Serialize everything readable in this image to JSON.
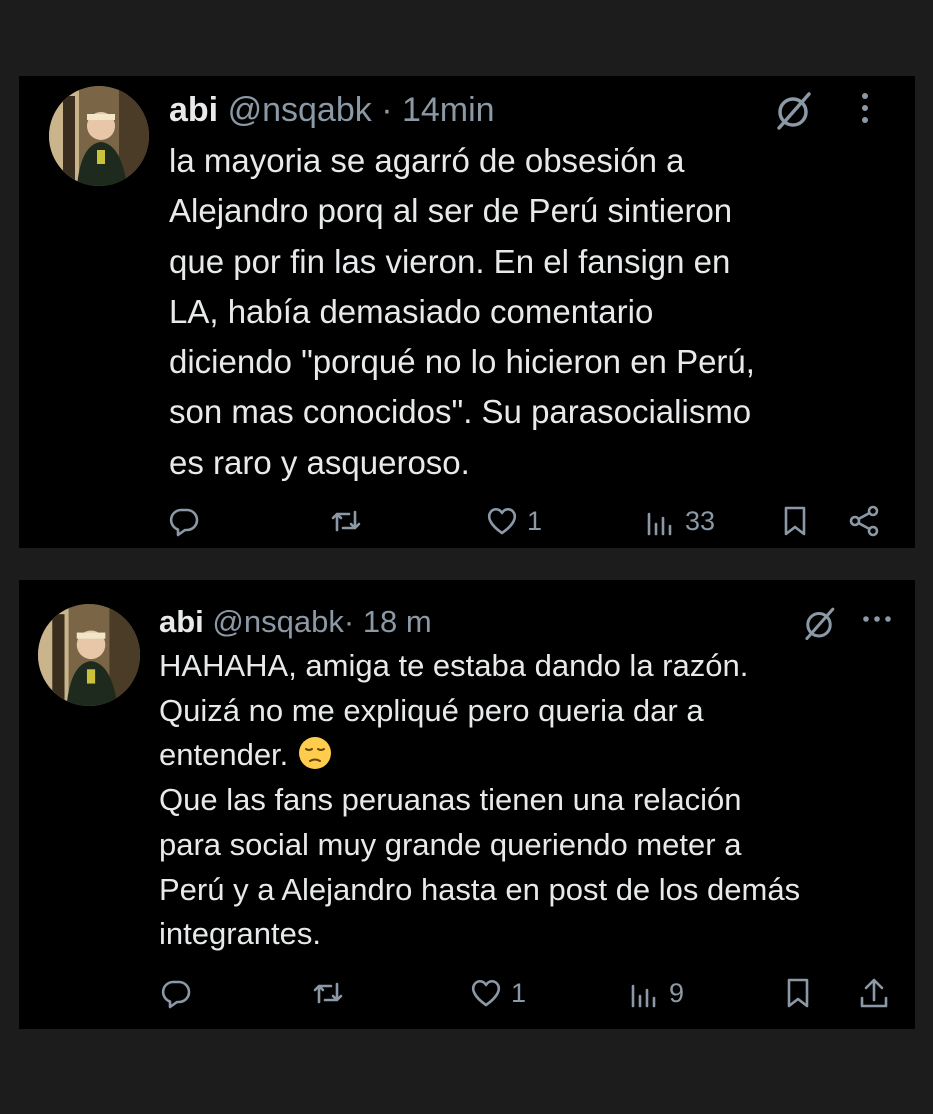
{
  "tweets": [
    {
      "name": "abi",
      "handle": "@nsqabk",
      "separator": "·",
      "time": "14min",
      "text": "la mayoria se agarró de obsesión a\nAlejandro porq al ser de Perú sintieron\nque por fin las vieron. En el fansign en\nLA, había demasiado comentario\ndiciendo \"porqué no lo hicieron en Perú,\nson mas conocidos\". Su parasocialismo\nes raro y asqueroso.",
      "likes": "1",
      "views": "33",
      "icons": [
        "reply-icon",
        "retweet-icon",
        "heart-icon",
        "views-icon",
        "bookmark-icon",
        "share-icon"
      ]
    },
    {
      "name": "abi",
      "handle": "@nsqabk",
      "separator": "·",
      "time": "18 m",
      "text_before_emoji": "HAHAHA, amiga te estaba dando la razón.\nQuizá no me expliqué pero queria dar a\nentender. ",
      "text_after_emoji": "\nQue las fans peruanas tienen una relación\npara social muy grande queriendo meter a\nPerú y a Alejandro hasta en post de los demás\nintegrantes.",
      "emoji": "pensive-face",
      "likes": "1",
      "views": "9",
      "icons": [
        "reply-icon",
        "retweet-icon",
        "heart-icon",
        "views-icon",
        "bookmark-icon",
        "upload-icon"
      ]
    }
  ],
  "colors": {
    "background": "#1c1c1c",
    "card": "#000000",
    "text": "#e7e9ea",
    "muted": "#8b98a5"
  }
}
